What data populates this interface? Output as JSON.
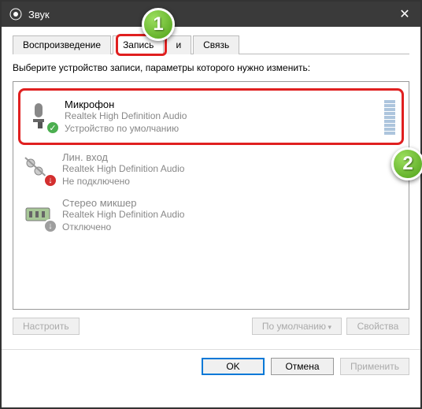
{
  "window": {
    "title": "Звук"
  },
  "tabs": {
    "playback": "Воспроизведение",
    "recording": "Запись",
    "sounds": "и",
    "communications": "Связь"
  },
  "instruction": "Выберите устройство записи, параметры которого нужно изменить:",
  "devices": [
    {
      "name": "Микрофон",
      "desc1": "Realtek High Definition Audio",
      "desc2": "Устройство по умолчанию"
    },
    {
      "name": "Лин. вход",
      "desc1": "Realtek High Definition Audio",
      "desc2": "Не подключено"
    },
    {
      "name": "Стерео микшер",
      "desc1": "Realtek High Definition Audio",
      "desc2": "Отключено"
    }
  ],
  "buttons": {
    "configure": "Настроить",
    "set_default": "По умолчанию",
    "properties": "Свойства",
    "ok": "OK",
    "cancel": "Отмена",
    "apply": "Применить"
  },
  "callouts": {
    "one": "1",
    "two": "2"
  }
}
